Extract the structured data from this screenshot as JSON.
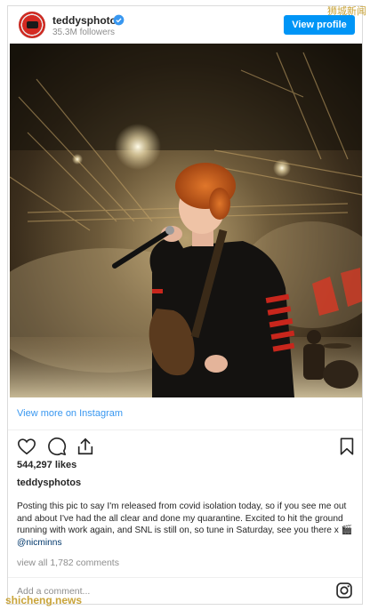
{
  "header": {
    "username": "teddysphotos",
    "followers": "35.3M followers",
    "view_profile_label": "View profile"
  },
  "watermarks": {
    "top": "狮城新闻",
    "bottom": "shicheng.news"
  },
  "post": {
    "view_more": "View more on Instagram",
    "likes": "544,297 likes",
    "caption_user": "teddysphotos",
    "caption_text": "Posting this pic to say I'm released from covid isolation today, so if you see me out and about I've had the all clear and done my quarantine. Excited to hit the ground running with work again, and SNL is still on, so tune in Saturday, see you there x 🎬 ",
    "caption_mention": "@nicminns",
    "comments_link": "view all 1,782 comments",
    "add_comment_placeholder": "Add a comment..."
  },
  "icons": {
    "like": "heart-icon",
    "comment": "comment-icon",
    "share": "share-icon",
    "save": "bookmark-icon",
    "instagram": "instagram-icon",
    "verified": "verified-badge-icon"
  },
  "colors": {
    "accent": "#0095f6",
    "link": "#3897f0",
    "muted": "#8e8e8e",
    "watermark": "#c9a43a"
  }
}
